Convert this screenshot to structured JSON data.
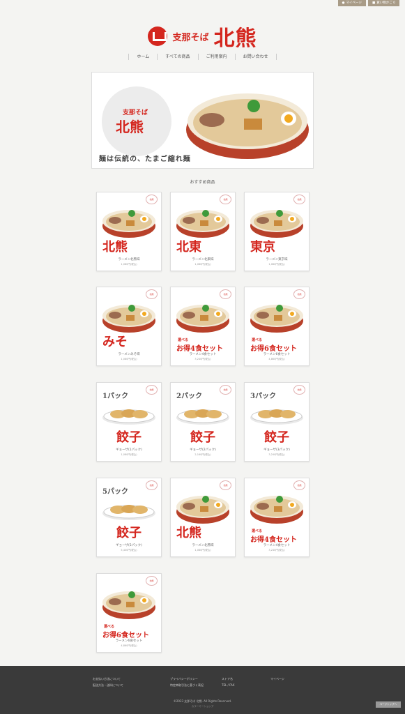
{
  "topbar": {
    "mypage": "マイページ",
    "cart": "買い物かご 0"
  },
  "brand": {
    "sub": "支那そば",
    "main": "北熊"
  },
  "nav": [
    "ホーム",
    "すべての商品",
    "ご利用案内",
    "お問い合わせ"
  ],
  "hero": {
    "sub": "支那そば",
    "main": "北熊",
    "tagline": "麺は伝統の、たまご縮れ麺"
  },
  "section_title": "おすすめ商品",
  "products": [
    {
      "label": "北熊",
      "name": "ラーメン北熊味",
      "price": "1,080円(税込)",
      "kind": "ramen"
    },
    {
      "label": "北東",
      "name": "ラーメン北東味",
      "price": "1,080円(税込)",
      "kind": "ramen"
    },
    {
      "label": "東京",
      "name": "ラーメン東京味",
      "price": "1,080円(税込)",
      "kind": "ramen"
    },
    {
      "label": "みそ",
      "name": "ラーメンみそ味",
      "price": "1,080円(税込)",
      "kind": "ramen"
    },
    {
      "sub": "選べる",
      "label": "お得4食セット",
      "name": "ラーメン4食セット",
      "price": "3,240円(税込)",
      "kind": "set"
    },
    {
      "sub": "選べる",
      "label": "お得6食セット",
      "name": "ラーメン6食セット",
      "price": "4,860円(税込)",
      "kind": "set"
    },
    {
      "top": "1パック",
      "label": "餃子",
      "name": "ギョーザ(1パック)",
      "price": "1,080円(税込)",
      "kind": "gyoza"
    },
    {
      "top": "2パック",
      "label": "餃子",
      "name": "ギョーザ(2パック)",
      "price": "2,160円(税込)",
      "kind": "gyoza"
    },
    {
      "top": "3パック",
      "label": "餃子",
      "name": "ギョーザ(3パック)",
      "price": "3,240円(税込)",
      "kind": "gyoza"
    },
    {
      "top": "5パック",
      "label": "餃子",
      "name": "ギョーザ(5パック)",
      "price": "5,400円(税込)",
      "kind": "gyoza"
    },
    {
      "label": "北熊",
      "name": "ラーメン北熊味",
      "price": "1,080円(税込)",
      "kind": "ramen"
    },
    {
      "sub": "選べる",
      "label": "お得4食セット",
      "name": "ラーメン4食セット",
      "price": "3,240円(税込)",
      "kind": "set"
    },
    {
      "sub": "選べる",
      "label": "お得6食セット",
      "name": "ラーメン6食セット",
      "price": "4,860円(税込)",
      "kind": "set"
    }
  ],
  "badge_text": "北熊",
  "footer": {
    "col1": [
      "お支払い方法について",
      "配送方法・送料について"
    ],
    "col2": [
      "プライバシーポリシー",
      "特定商取引法に基づく表記"
    ],
    "col3": [
      "ストア名",
      "TEL / FAX"
    ],
    "col4": [
      "マイページ"
    ],
    "copyright": "©2023 支那そば 北熊. All Rights Reserved.",
    "powered": "カラーミーショップ",
    "pagetop": "ページトップへ"
  }
}
